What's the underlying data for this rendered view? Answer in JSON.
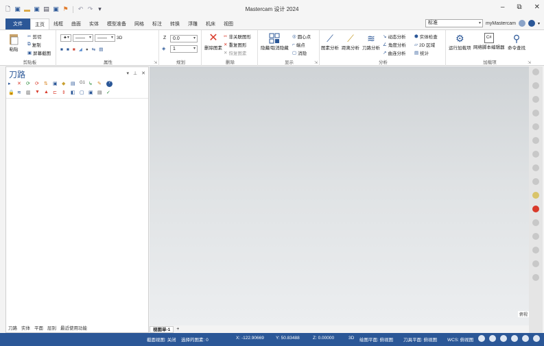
{
  "window": {
    "title": "Mastercam 设计 2024",
    "min": "–",
    "restore": "⧉",
    "close": "✕"
  },
  "tabs": [
    "文件",
    "主页",
    "线框",
    "曲面",
    "实体",
    "模型准备",
    "网格",
    "标注",
    "转换",
    "浮雕",
    "机床",
    "视图"
  ],
  "tabs_right": {
    "combo_value": "标准",
    "user": "myMastercam"
  },
  "ribbon": {
    "clipboard": {
      "paste": "粘贴",
      "cut": "剪切",
      "copy": "复制",
      "screenshot": "屏幕截图",
      "label": "剪贴板"
    },
    "attributes": {
      "label": "属性",
      "threeD": "3D"
    },
    "plan": {
      "z_label": "Z",
      "z_value": "0.0",
      "level_value": "1",
      "label": "规划"
    },
    "delete": {
      "delete_entities": "删除图素",
      "unrelated": "非关联图形",
      "redo": "重复图形",
      "restore": "恢复图素",
      "label": "删除"
    },
    "display": {
      "hide_show": "隐藏/取消隐藏",
      "center_point": "圆心点",
      "endpoint": "端点",
      "clear": "消隐",
      "label": "显示"
    },
    "analysis": {
      "entity": "图素分析",
      "distance": "距离分析",
      "toolpath": "刀路分析",
      "dynamic": "动态分析",
      "angle": "角度分析",
      "curvature": "曲连分析",
      "solid_check": "实体检查",
      "area2d": "2D 区域",
      "stats": "统计",
      "label": "分析"
    },
    "addins": {
      "run": "运行加载项",
      "script": "网络脚本编辑器",
      "command": "命令查找",
      "label": "加载项"
    }
  },
  "panel": {
    "title": "刀路",
    "tabs": [
      "刀路",
      "实体",
      "平面",
      "层别",
      "最近使用功能"
    ]
  },
  "viewport": {
    "tab": "视图单-1",
    "plus": "+",
    "corner": "俯视"
  },
  "status": {
    "section": "截面视图: 关闭",
    "selected": "选择的图素: 0",
    "x": "X:  -122.90669",
    "y": "Y:  50.83488",
    "z": "Z:  0.00000",
    "mode": "3D",
    "cplane": "绘图平面: 俯视图",
    "tplane": "刀具平面: 俯视图",
    "wcs": "WCS: 俯视图"
  },
  "colors": {
    "accent": "#2b5797",
    "status": "#2b5797"
  }
}
